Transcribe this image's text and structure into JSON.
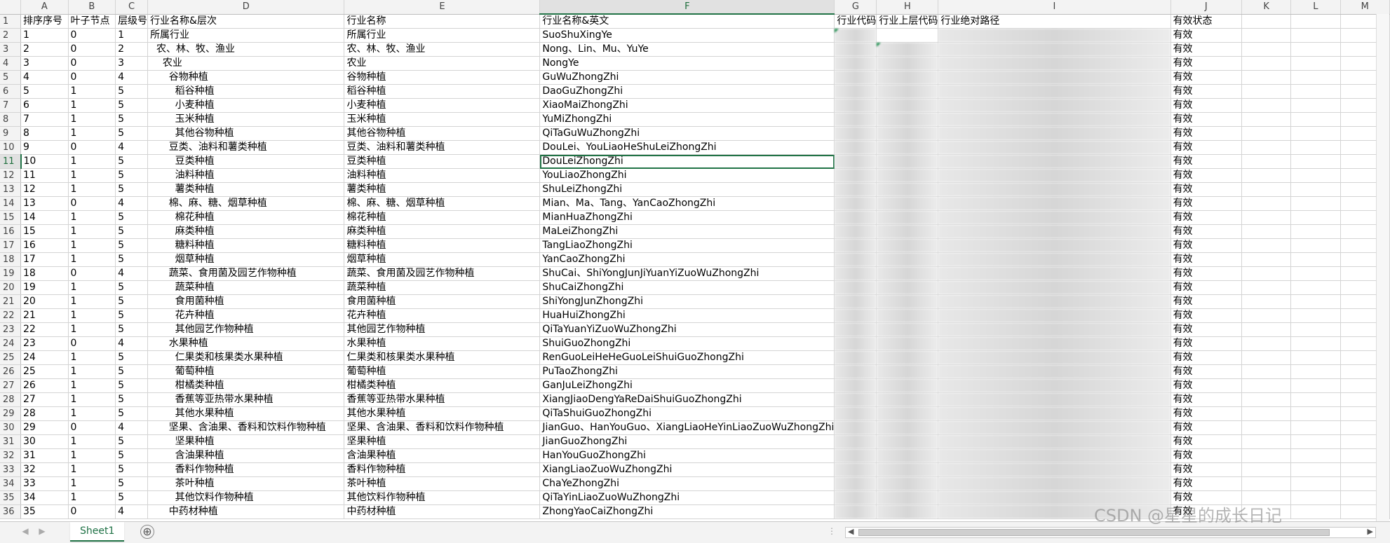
{
  "columns": [
    "A",
    "B",
    "C",
    "D",
    "E",
    "F",
    "G",
    "H",
    "I",
    "J",
    "K",
    "L",
    "M"
  ],
  "active_col": "F",
  "active_row": 11,
  "rows": [
    {
      "n": "1",
      "cells": [
        "排序序号",
        "叶子节点",
        "层级号",
        "行业名称&层次",
        "行业名称",
        "行业名称&英文",
        "行业代码",
        "行业上层代码",
        "行业绝对路径",
        "有效状态",
        "",
        "",
        ""
      ]
    },
    {
      "n": "2",
      "cells": [
        "1",
        "0",
        "1",
        "所属行业",
        "所属行业",
        "SuoShuXingYe",
        "A0000",
        "",
        "/00000",
        "有效",
        "",
        "",
        ""
      ]
    },
    {
      "n": "3",
      "cells": [
        "2",
        "0",
        "2",
        "  农、林、牧、渔业",
        "农、林、牧、渔业",
        "Nong、Lin、Mu、YuYe",
        "A0000",
        "A0000",
        "/00000/A0000",
        "有效",
        "",
        "",
        ""
      ]
    },
    {
      "n": "4",
      "cells": [
        "3",
        "0",
        "3",
        "    农业",
        "农业",
        "NongYe",
        "A0100",
        "A0000",
        "/00000/A0000/A0100",
        "有效",
        "",
        "",
        ""
      ]
    },
    {
      "n": "5",
      "cells": [
        "4",
        "0",
        "4",
        "      谷物种植",
        "谷物种植",
        "GuWuZhongZhi",
        "A0110",
        "A0100",
        "/00000/A0000/A0100/A0110",
        "有效",
        "",
        "",
        ""
      ]
    },
    {
      "n": "6",
      "cells": [
        "5",
        "1",
        "5",
        "        稻谷种植",
        "稻谷种植",
        "DaoGuZhongZhi",
        "A0111",
        "A0110",
        "/00000/A0000/A0100/A0110/A0111",
        "有效",
        "",
        "",
        ""
      ]
    },
    {
      "n": "7",
      "cells": [
        "6",
        "1",
        "5",
        "        小麦种植",
        "小麦种植",
        "XiaoMaiZhongZhi",
        "A0112",
        "A0110",
        "/00000/A0000/A0100/A0110/A0112",
        "有效",
        "",
        "",
        ""
      ]
    },
    {
      "n": "8",
      "cells": [
        "7",
        "1",
        "5",
        "        玉米种植",
        "玉米种植",
        "YuMiZhongZhi",
        "A0113",
        "A0110",
        "/00000/A0000/A0100/A0110/A0113",
        "有效",
        "",
        "",
        ""
      ]
    },
    {
      "n": "9",
      "cells": [
        "8",
        "1",
        "5",
        "        其他谷物种植",
        "其他谷物种植",
        "QiTaGuWuZhongZhi",
        "A0119",
        "A0110",
        "/00000/A0000/A0100/A0110/A0119",
        "有效",
        "",
        "",
        ""
      ]
    },
    {
      "n": "10",
      "cells": [
        "9",
        "0",
        "4",
        "      豆类、油料和薯类种植",
        "豆类、油料和薯类种植",
        "DouLei、YouLiaoHeShuLeiZhongZhi",
        "A0120",
        "A0100",
        "/00000/A0000/A0100/A0120",
        "有效",
        "",
        "",
        ""
      ]
    },
    {
      "n": "11",
      "cells": [
        "10",
        "1",
        "5",
        "        豆类种植",
        "豆类种植",
        "DouLeiZhongZhi",
        "A0121",
        "A0120",
        "/00000/A0000/A0100/A0120/A0121",
        "有效",
        "",
        "",
        ""
      ]
    },
    {
      "n": "12",
      "cells": [
        "11",
        "1",
        "5",
        "        油料种植",
        "油料种植",
        "YouLiaoZhongZhi",
        "A0122",
        "A0120",
        "/00000/A0000/A0100/A0120/A0122",
        "有效",
        "",
        "",
        ""
      ]
    },
    {
      "n": "13",
      "cells": [
        "12",
        "1",
        "5",
        "        薯类种植",
        "薯类种植",
        "ShuLeiZhongZhi",
        "A0123",
        "A0120",
        "/00000/A0000/A0100/A0120/A0123",
        "有效",
        "",
        "",
        ""
      ]
    },
    {
      "n": "14",
      "cells": [
        "13",
        "0",
        "4",
        "      棉、麻、糖、烟草种植",
        "棉、麻、糖、烟草种植",
        "Mian、Ma、Tang、YanCaoZhongZhi",
        "A0130",
        "A0100",
        "/00000/A0000/A0100/A0130",
        "有效",
        "",
        "",
        ""
      ]
    },
    {
      "n": "15",
      "cells": [
        "14",
        "1",
        "5",
        "        棉花种植",
        "棉花种植",
        "MianHuaZhongZhi",
        "A0131",
        "A0130",
        "/00000/A0000/A0100/A0130/A0131",
        "有效",
        "",
        "",
        ""
      ]
    },
    {
      "n": "16",
      "cells": [
        "15",
        "1",
        "5",
        "        麻类种植",
        "麻类种植",
        "MaLeiZhongZhi",
        "A0132",
        "A0130",
        "/00000/A0000/A0100/A0130/A0132",
        "有效",
        "",
        "",
        ""
      ]
    },
    {
      "n": "17",
      "cells": [
        "16",
        "1",
        "5",
        "        糖料种植",
        "糖料种植",
        "TangLiaoZhongZhi",
        "A0133",
        "A0130",
        "/00000/A0000/A0100/A0130/A0133",
        "有效",
        "",
        "",
        ""
      ]
    },
    {
      "n": "18",
      "cells": [
        "17",
        "1",
        "5",
        "        烟草种植",
        "烟草种植",
        "YanCaoZhongZhi",
        "A0134",
        "A0130",
        "/00000/A0000/A0100/A0130/A0134",
        "有效",
        "",
        "",
        ""
      ]
    },
    {
      "n": "19",
      "cells": [
        "18",
        "0",
        "4",
        "      蔬菜、食用菌及园艺作物种植",
        "蔬菜、食用菌及园艺作物种植",
        "ShuCai、ShiYongJunJiYuanYiZuoWuZhongZhi",
        "A0140",
        "A0100",
        "/00000/A0000/A0100/A0140",
        "有效",
        "",
        "",
        ""
      ]
    },
    {
      "n": "20",
      "cells": [
        "19",
        "1",
        "5",
        "        蔬菜种植",
        "蔬菜种植",
        "ShuCaiZhongZhi",
        "A0141",
        "A0140",
        "/00000/A0000/A0100/A0140/A0141",
        "有效",
        "",
        "",
        ""
      ]
    },
    {
      "n": "21",
      "cells": [
        "20",
        "1",
        "5",
        "        食用菌种植",
        "食用菌种植",
        "ShiYongJunZhongZhi",
        "A0142",
        "A0140",
        "/00000/A0000/A0100/A0140/A0142",
        "有效",
        "",
        "",
        ""
      ]
    },
    {
      "n": "22",
      "cells": [
        "21",
        "1",
        "5",
        "        花卉种植",
        "花卉种植",
        "HuaHuiZhongZhi",
        "A0143",
        "A0140",
        "/00000/A0000/A0100/A0140/A0143",
        "有效",
        "",
        "",
        ""
      ]
    },
    {
      "n": "23",
      "cells": [
        "22",
        "1",
        "5",
        "        其他园艺作物种植",
        "其他园艺作物种植",
        "QiTaYuanYiZuoWuZhongZhi",
        "A0149",
        "A0140",
        "/00000/A0000/A0100/A0140/A0149",
        "有效",
        "",
        "",
        ""
      ]
    },
    {
      "n": "24",
      "cells": [
        "23",
        "0",
        "4",
        "      水果种植",
        "水果种植",
        "ShuiGuoZhongZhi",
        "A0150",
        "A0100",
        "/00000/A0000/A0100/A0150",
        "有效",
        "",
        "",
        ""
      ]
    },
    {
      "n": "25",
      "cells": [
        "24",
        "1",
        "5",
        "        仁果类和核果类水果种植",
        "仁果类和核果类水果种植",
        "RenGuoLeiHeHeGuoLeiShuiGuoZhongZhi",
        "A0151",
        "A0150",
        "/00000/A0000/A0100/A0150/A0151",
        "有效",
        "",
        "",
        ""
      ]
    },
    {
      "n": "26",
      "cells": [
        "25",
        "1",
        "5",
        "        葡萄种植",
        "葡萄种植",
        "PuTaoZhongZhi",
        "A0152",
        "A0150",
        "/00000/A0000/A0100/A0150/A0152",
        "有效",
        "",
        "",
        ""
      ]
    },
    {
      "n": "27",
      "cells": [
        "26",
        "1",
        "5",
        "        柑橘类种植",
        "柑橘类种植",
        "GanJuLeiZhongZhi",
        "A0153",
        "A0150",
        "/00000/A0000/A0100/A0150/A0153",
        "有效",
        "",
        "",
        ""
      ]
    },
    {
      "n": "28",
      "cells": [
        "27",
        "1",
        "5",
        "        香蕉等亚热带水果种植",
        "香蕉等亚热带水果种植",
        "XiangJiaoDengYaReDaiShuiGuoZhongZhi",
        "A0154",
        "A0150",
        "/00000/A0000/A0100/A0150/A0154",
        "有效",
        "",
        "",
        ""
      ]
    },
    {
      "n": "29",
      "cells": [
        "28",
        "1",
        "5",
        "        其他水果种植",
        "其他水果种植",
        "QiTaShuiGuoZhongZhi",
        "A0159",
        "A0150",
        "/00000/A0000/A0100/A0150/A0159",
        "有效",
        "",
        "",
        ""
      ]
    },
    {
      "n": "30",
      "cells": [
        "29",
        "0",
        "4",
        "      坚果、含油果、香料和饮料作物种植",
        "坚果、含油果、香料和饮料作物种植",
        "JianGuo、HanYouGuo、XiangLiaoHeYinLiaoZuoWuZhongZhi",
        "A0160",
        "A0100",
        "/00000/A0000/A0100/A0160",
        "有效",
        "",
        "",
        ""
      ]
    },
    {
      "n": "31",
      "cells": [
        "30",
        "1",
        "5",
        "        坚果种植",
        "坚果种植",
        "JianGuoZhongZhi",
        "A0161",
        "A0160",
        "/00000/A0000/A0100/A0160/A0161",
        "有效",
        "",
        "",
        ""
      ]
    },
    {
      "n": "32",
      "cells": [
        "31",
        "1",
        "5",
        "        含油果种植",
        "含油果种植",
        "HanYouGuoZhongZhi",
        "A0162",
        "A0160",
        "/00000/A0000/A0100/A0160/A0162",
        "有效",
        "",
        "",
        ""
      ]
    },
    {
      "n": "33",
      "cells": [
        "32",
        "1",
        "5",
        "        香料作物种植",
        "香料作物种植",
        "XiangLiaoZuoWuZhongZhi",
        "A0163",
        "A0160",
        "/00000/A0000/A0100/A0160/A0163",
        "有效",
        "",
        "",
        ""
      ]
    },
    {
      "n": "34",
      "cells": [
        "33",
        "1",
        "5",
        "        茶叶种植",
        "茶叶种植",
        "ChaYeZhongZhi",
        "A0164",
        "A0160",
        "/00000/A0000/A0100/A0160/A0164",
        "有效",
        "",
        "",
        ""
      ]
    },
    {
      "n": "35",
      "cells": [
        "34",
        "1",
        "5",
        "        其他饮料作物种植",
        "其他饮料作物种植",
        "QiTaYinLiaoZuoWuZhongZhi",
        "A0169",
        "A0160",
        "/00000/A0000/A0100/A0160/A0169",
        "有效",
        "",
        "",
        ""
      ]
    },
    {
      "n": "36",
      "cells": [
        "35",
        "0",
        "4",
        "      中药材种植",
        "中药材种植",
        "ZhongYaoCaiZhongZhi",
        "A0170",
        "A0100",
        "/00000/A0000/A0100/A0170",
        "有效",
        "",
        "",
        ""
      ]
    }
  ],
  "sheet_tab": "Sheet1",
  "add_sheet_symbol": "⊕",
  "watermark": "CSDN @星星的成长日记",
  "colors": {
    "accent": "#217346",
    "header_bg": "#f3f3f3",
    "grid": "#d4d4d4"
  },
  "icons": {
    "prev": "left-arrow-icon",
    "next": "right-arrow-icon",
    "add": "add-sheet-icon"
  }
}
